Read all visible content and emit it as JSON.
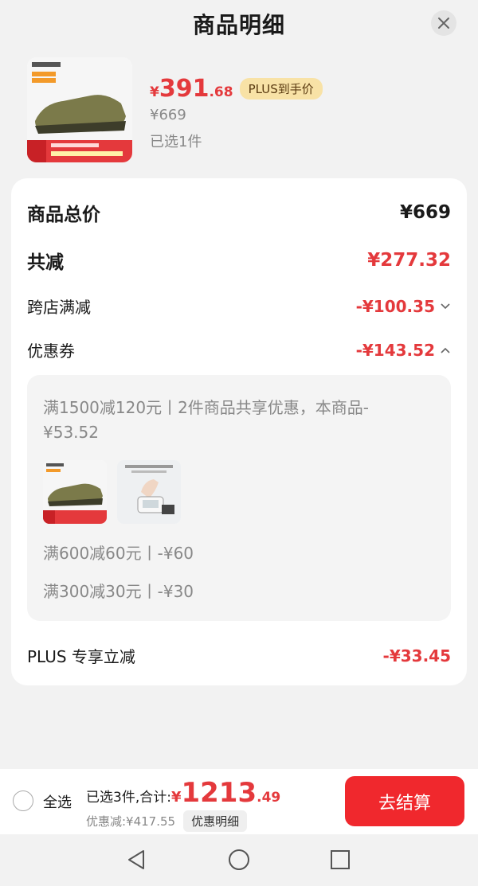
{
  "header": {
    "title": "商品明细",
    "close_icon": "close-icon"
  },
  "product": {
    "image": "shoe-image",
    "price_symbol": "¥",
    "price_int": "391",
    "price_dec": ".68",
    "plus_tag": "PLUS到手价",
    "original_price": "¥669",
    "selected": "已选1件"
  },
  "breakdown": {
    "total_label": "商品总价",
    "total_value": "¥669",
    "reduce_label": "共减",
    "reduce_value": "¥277.32",
    "cross_store_label": "跨店满减",
    "cross_store_value": "-¥100.35",
    "coupon_label": "优惠券",
    "coupon_value": "-¥143.52",
    "coupon_desc": "满1500减120元丨2件商品共享优惠，本商品-¥53.52",
    "coupon_line_1": "满600减60元丨-¥60",
    "coupon_line_2": "满300减30元丨-¥30",
    "plus_label": "PLUS 专享立减",
    "plus_value": "-¥33.45"
  },
  "bottom": {
    "select_all": "全选",
    "summary_label": "已选3件,合计:",
    "sum_symbol": "¥",
    "sum_int": "1213",
    "sum_dec": ".49",
    "discount": "优惠减:¥417.55",
    "detail_button": "优惠明细",
    "checkout": "去结算"
  },
  "colors": {
    "accent": "#e4393c",
    "checkout": "#f0282d",
    "plus_tag_bg": "#f8e2a6"
  }
}
